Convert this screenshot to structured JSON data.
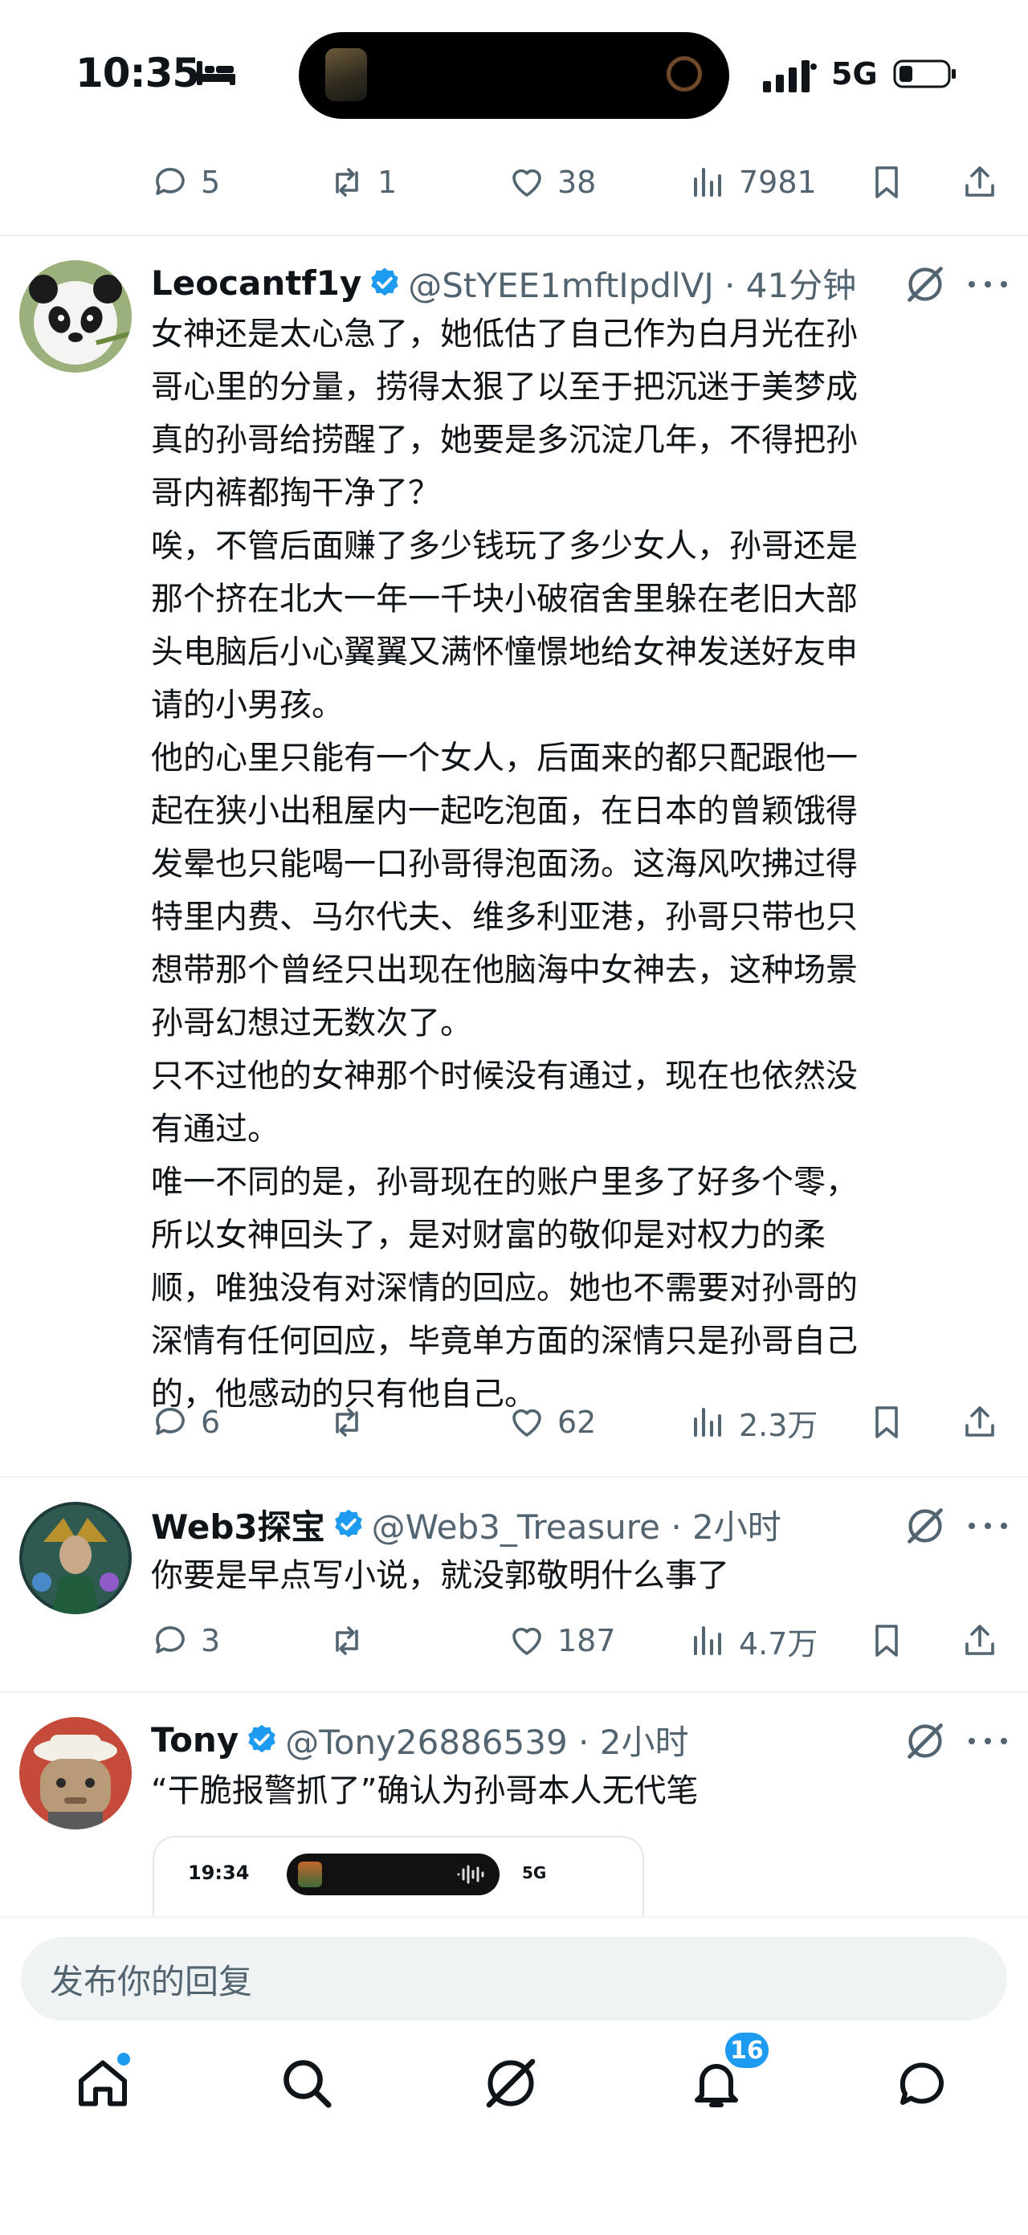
{
  "status_bar": {
    "time": "10:35",
    "network": "5G",
    "icons": [
      "bed-icon",
      "signal-icon",
      "battery-icon"
    ]
  },
  "colors": {
    "accent": "#1d9bf0",
    "text": "#0f1419",
    "muted": "#536471",
    "divider": "#eff3f4"
  },
  "top_actions": {
    "replies": "5",
    "reposts": "1",
    "likes": "38",
    "views": "7981"
  },
  "tweets": [
    {
      "name": "Leocantf1y",
      "handle_time": "@StYEE1mftIpdlVJ · 41分钟",
      "lines": [
        "女神还是太心急了，她低估了自己作为白月光在孙",
        "哥心里的分量，捞得太狠了以至于把沉迷于美梦成",
        "真的孙哥给捞醒了，她要是多沉淀几年，不得把孙",
        "哥内裤都掏干净了？",
        "唉，不管后面赚了多少钱玩了多少女人，孙哥还是",
        "那个挤在北大一年一千块小破宿舍里躲在老旧大部",
        "头电脑后小心翼翼又满怀憧憬地给女神发送好友申",
        "请的小男孩。",
        "他的心里只能有一个女人，后面来的都只配跟他一",
        "起在狭小出租屋内一起吃泡面，在日本的曾颖饿得",
        "发晕也只能喝一口孙哥得泡面汤。这海风吹拂过得",
        "特里内费、马尔代夫、维多利亚港，孙哥只带也只",
        "想带那个曾经只出现在他脑海中女神去，这种场景",
        "孙哥幻想过无数次了。",
        "只不过他的女神那个时候没有通过，现在也依然没",
        "有通过。",
        "唯一不同的是，孙哥现在的账户里多了好多个零，",
        "所以女神回头了，是对财富的敬仰是对权力的柔",
        "顺，唯独没有对深情的回应。她也不需要对孙哥的",
        "深情有任何回应，毕竟单方面的深情只是孙哥自己",
        "的，他感动的只有他自己。"
      ],
      "actions": {
        "replies": "6",
        "reposts": "",
        "likes": "62",
        "views": "2.3万"
      }
    },
    {
      "name": "Web3探宝",
      "handle_time": "@Web3_Treasure · 2小时",
      "lines": [
        "你要是早点写小说，就没郭敬明什么事了"
      ],
      "actions": {
        "replies": "3",
        "reposts": "",
        "likes": "187",
        "views": "4.7万"
      }
    },
    {
      "name": "Tony",
      "handle_time": "@Tony26886539 · 2小时",
      "lines": [
        "“干脆报警抓了”确认为孙哥本人无代笔"
      ],
      "embed": {
        "time": "19:34",
        "network": "5G"
      }
    }
  ],
  "reply_bar": {
    "placeholder": "发布你的回复"
  },
  "tabbar": {
    "items": [
      "home-icon",
      "search-icon",
      "grok-icon",
      "notifications-icon",
      "messages-icon"
    ],
    "notification_count": "16"
  }
}
